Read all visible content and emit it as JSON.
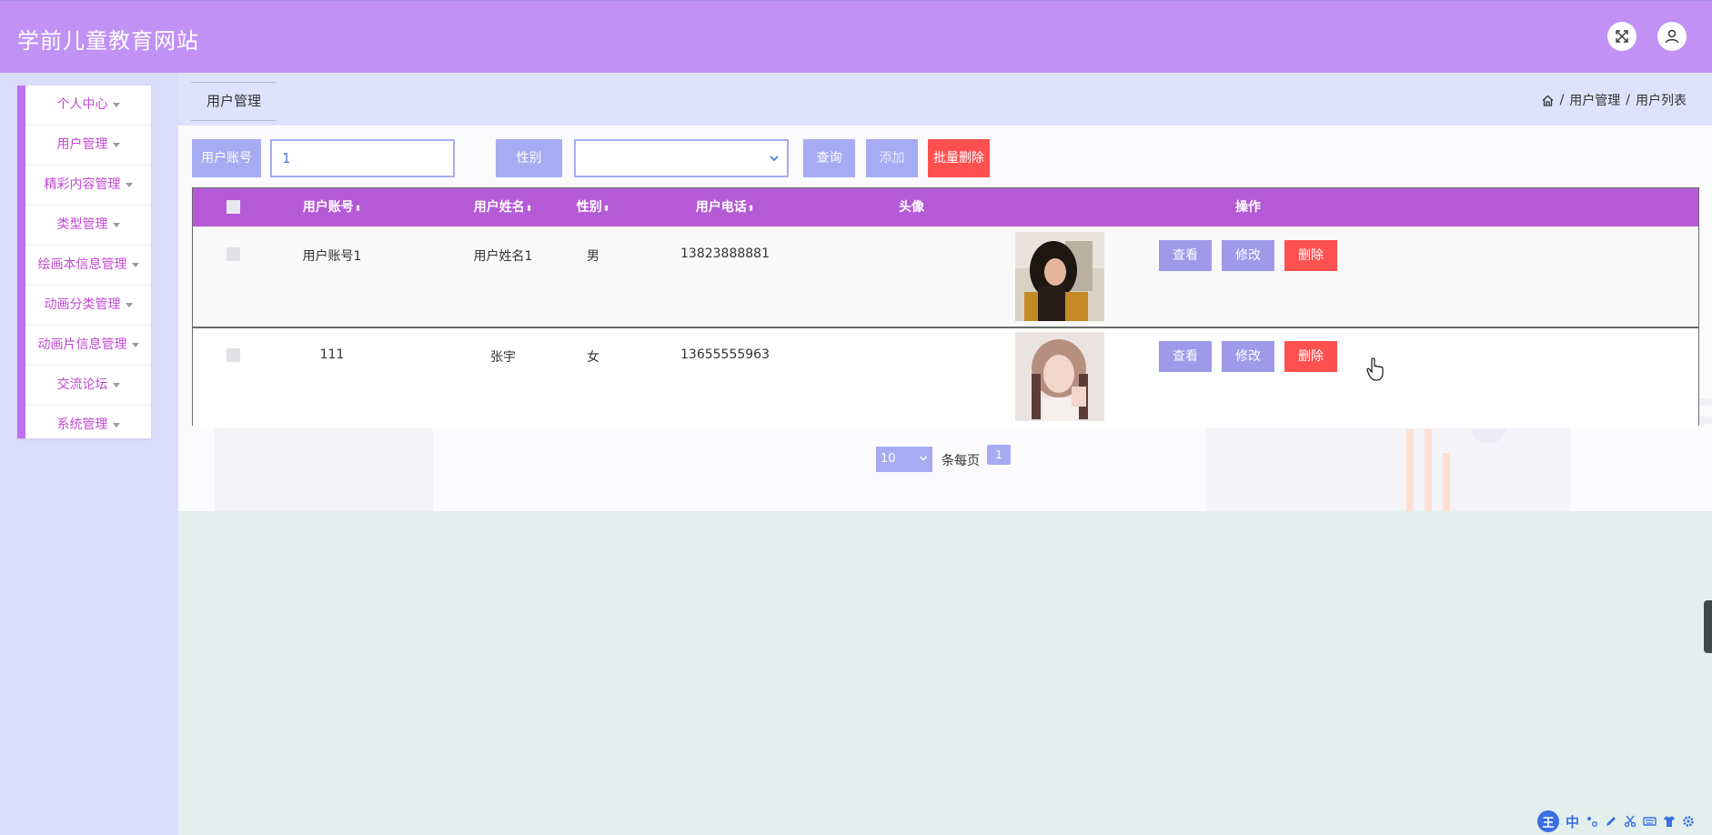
{
  "header": {
    "site_title": "学前儿童教育网站"
  },
  "sidebar": {
    "items": [
      {
        "label": "个人中心"
      },
      {
        "label": "用户管理"
      },
      {
        "label": "精彩内容管理"
      },
      {
        "label": "类型管理"
      },
      {
        "label": "绘画本信息管理"
      },
      {
        "label": "动画分类管理"
      },
      {
        "label": "动画片信息管理"
      },
      {
        "label": "交流论坛"
      },
      {
        "label": "系统管理"
      }
    ]
  },
  "tab": {
    "label": "用户管理"
  },
  "breadcrumb": {
    "level1": "用户管理",
    "level2": "用户列表",
    "separator": "/"
  },
  "search": {
    "account_label": "用户账号",
    "account_value": "1",
    "gender_label": "性别",
    "gender_value": "",
    "query_button": "查询",
    "add_button": "添加",
    "batch_delete_button": "批量删除"
  },
  "table": {
    "columns": {
      "account": "用户账号",
      "name": "用户姓名",
      "gender": "性别",
      "phone": "用户电话",
      "avatar": "头像",
      "actions": "操作"
    },
    "sort_glyph": "⬍",
    "rows": [
      {
        "account": "用户账号1",
        "name": "用户姓名1",
        "gender": "男",
        "phone": "13823888881"
      },
      {
        "account": "111",
        "name": "张宇",
        "gender": "女",
        "phone": "13655555963"
      }
    ],
    "actions": {
      "view": "查看",
      "edit": "修改",
      "delete": "删除"
    }
  },
  "pagination": {
    "page_size": "10",
    "per_page_text": "条每页",
    "current_page": "1"
  },
  "ime_toolbar": {
    "logo": "王",
    "mode": "中"
  },
  "colors": {
    "header": "#c191f5",
    "table_header": "#b45ad6",
    "label_button": "#a6abf2",
    "action_button": "#9f99ea",
    "danger": "#ff5050",
    "sidebar_text": "#c149d1"
  }
}
